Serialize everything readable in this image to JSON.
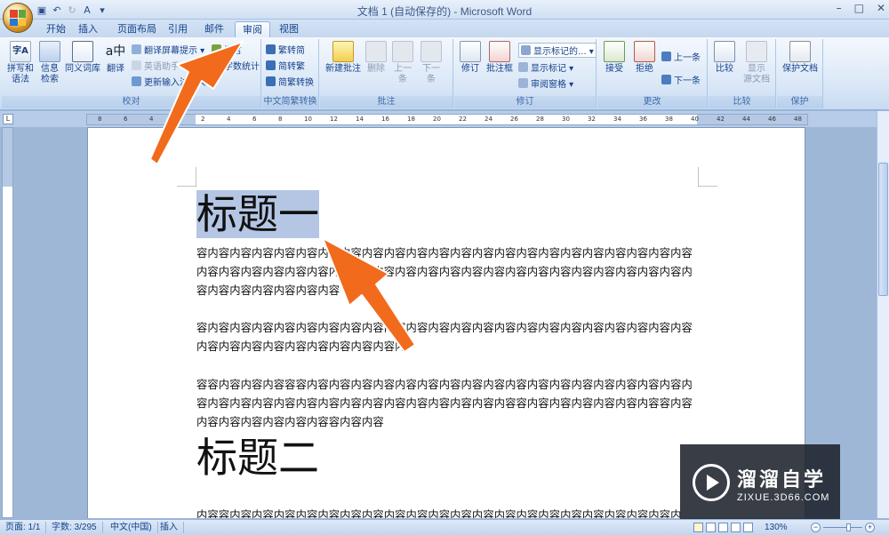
{
  "app": {
    "title": "文档 1 (自动保存的) - Microsoft Word",
    "window_controls": [
      "–",
      "□",
      "✕"
    ]
  },
  "quick_access": [
    "save-icon",
    "undo-icon",
    "redo-icon",
    "format-icon",
    "customize-icon"
  ],
  "tabs": [
    {
      "label": "开始"
    },
    {
      "label": "插入"
    },
    {
      "label": "页面布局"
    },
    {
      "label": "引用"
    },
    {
      "label": "邮件"
    },
    {
      "label": "审阅",
      "active": true
    },
    {
      "label": "视图"
    }
  ],
  "ribbon": {
    "proofing": {
      "label": "校对",
      "spelling": "拼写和\n语法",
      "research": "信息\n检索",
      "thesaurus": "同义词库",
      "translate": "翻译",
      "translate_tip": "翻译屏幕提示 ▾",
      "english_assistant": "英语助手",
      "update_ime": "更新输入法词典",
      "language": "语言",
      "word_count": "字数统计"
    },
    "chinese_conversion": {
      "label": "中文简繁转换",
      "to_simplified": "繁转简",
      "to_traditional": "简转繁",
      "conversion": "简繁转换"
    },
    "comments": {
      "label": "批注",
      "new": "新建批注",
      "delete": "删除",
      "previous": "上一条",
      "next": "下一条"
    },
    "tracking": {
      "label": "修订",
      "track": "修订",
      "balloons": "批注框",
      "display_for_review": "显示标记的... ▾",
      "show_markup": "显示标记 ▾",
      "reviewing_pane": "审阅窗格 ▾"
    },
    "changes": {
      "label": "更改",
      "accept": "接受",
      "reject": "拒绝",
      "previous": "上一条",
      "next": "下一条"
    },
    "compare": {
      "label": "比较",
      "compare": "比较",
      "show_source": "显示\n源文档"
    },
    "protect": {
      "label": "保护",
      "protect_document": "保护文档"
    }
  },
  "ruler": {
    "marks": [
      "8",
      "6",
      "4",
      "2",
      "2",
      "4",
      "6",
      "8",
      "10",
      "12",
      "14",
      "16",
      "18",
      "20",
      "22",
      "24",
      "26",
      "28",
      "30",
      "32",
      "34",
      "36",
      "38",
      "40",
      "42",
      "44",
      "46",
      "48"
    ]
  },
  "document": {
    "heading1": "标题一",
    "para1": "容内容内容内容内容内容内容内容内容内容内容内容内容内容内容内容内容内容内容内容内容内容内容内容内容内容内容内容内容内容内容内容内容内容内容内容内容内容内容内容内容内容内容内容内容内容内容内容内容内容内容内容",
    "para2": "容内容内容内容内容内容内容内容内容内容内容内容内容内容内容内容内容内容内容内容内容内容内容内容内容内容内容内容内容内容内容内容内",
    "para3": "容容内容内容内容容容内容内容内容内容内容内容内容内容内容内容内容内容内容内容内容内容内容内容内容内容内容内容内容内容内容内容内容内容内容内容内容内容容内容内容内容内容内容内容容内容内容内容内容内容内容内容容内容内容",
    "heading2": "标题二",
    "para4": "内容容内容内容内容内容内容内容内容内容内容内容内容内容内容内容内容内容内容内容内容内容内"
  },
  "status": {
    "page": "页面: 1/1",
    "words": "字数: 3/295",
    "language": "中文(中国)",
    "mode": "插入",
    "zoom": "130%"
  },
  "watermark": {
    "name": "溜溜自学",
    "url": "ZIXUE.3D66.COM"
  }
}
